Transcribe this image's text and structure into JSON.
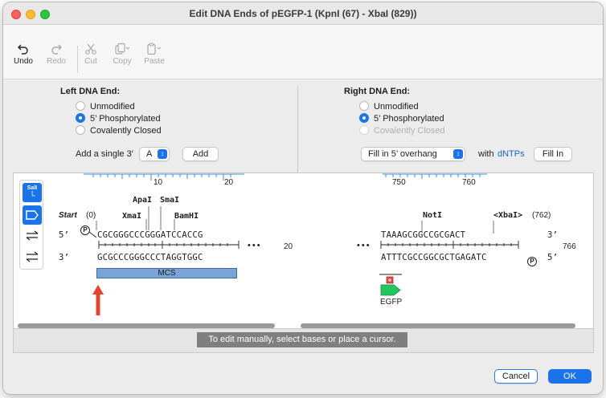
{
  "window": {
    "title": "Edit DNA Ends of pEGFP-1 (KpnI (67) - XbaI (829))"
  },
  "toolbar": {
    "undo": "Undo",
    "redo": "Redo",
    "cut": "Cut",
    "copy": "Copy",
    "paste": "Paste"
  },
  "left": {
    "heading": "Left DNA End:",
    "options": [
      "Unmodified",
      "5’ Phosphorylated",
      "Covalently Closed"
    ],
    "selected": "5’ Phosphorylated",
    "add_label": "Add a single 3′",
    "base_value": "A",
    "add_button": "Add"
  },
  "right": {
    "heading": "Right DNA End:",
    "options": [
      "Unmodified",
      "5’ Phosphorylated",
      "Covalently Closed"
    ],
    "selected": "5’ Phosphorylated",
    "fill_value": "Fill in 5’ overhang",
    "with_label": "with",
    "dntps_link": "dNTPs",
    "fill_button": "Fill In"
  },
  "sequence_left": {
    "ruler": [
      "10",
      "20"
    ],
    "start_label": "Start",
    "start_pos": "(0)",
    "enzymes": [
      "ApaI",
      "SmaI",
      "XmaI",
      "BamHI"
    ],
    "top_label": "5’",
    "top_seq": "CGCGGGCCCGGGATCCACCG",
    "bottom_label": "3’",
    "bottom_seq": "GCGCCCGGGCCCTAGGTGGC",
    "end_pos": "20",
    "feature": "MCS",
    "ellipsis": "•••"
  },
  "sequence_right": {
    "ruler": [
      "750",
      "760"
    ],
    "enzymes": [
      "NotI",
      "<XbaI>"
    ],
    "xbai_pos": "(762)",
    "top_seq": "TAAAGCGGCCGCGACT",
    "top_label": "3’",
    "bottom_seq": "ATTTCGCCGGCGCTGAGATC",
    "bottom_label": "5’",
    "end_pos": "766",
    "feature": "EGFP",
    "ellipsis": "•••"
  },
  "side_tools": {
    "sall": "SalI"
  },
  "status": "To edit manually, select bases or place a cursor.",
  "footer": {
    "cancel": "Cancel",
    "ok": "OK"
  },
  "phospho_symbol": "P",
  "colors": {
    "accent": "#1a73e8",
    "mcs": "#7aa3d6",
    "egfp": "#22c55e",
    "arrow": "#e8412e"
  }
}
